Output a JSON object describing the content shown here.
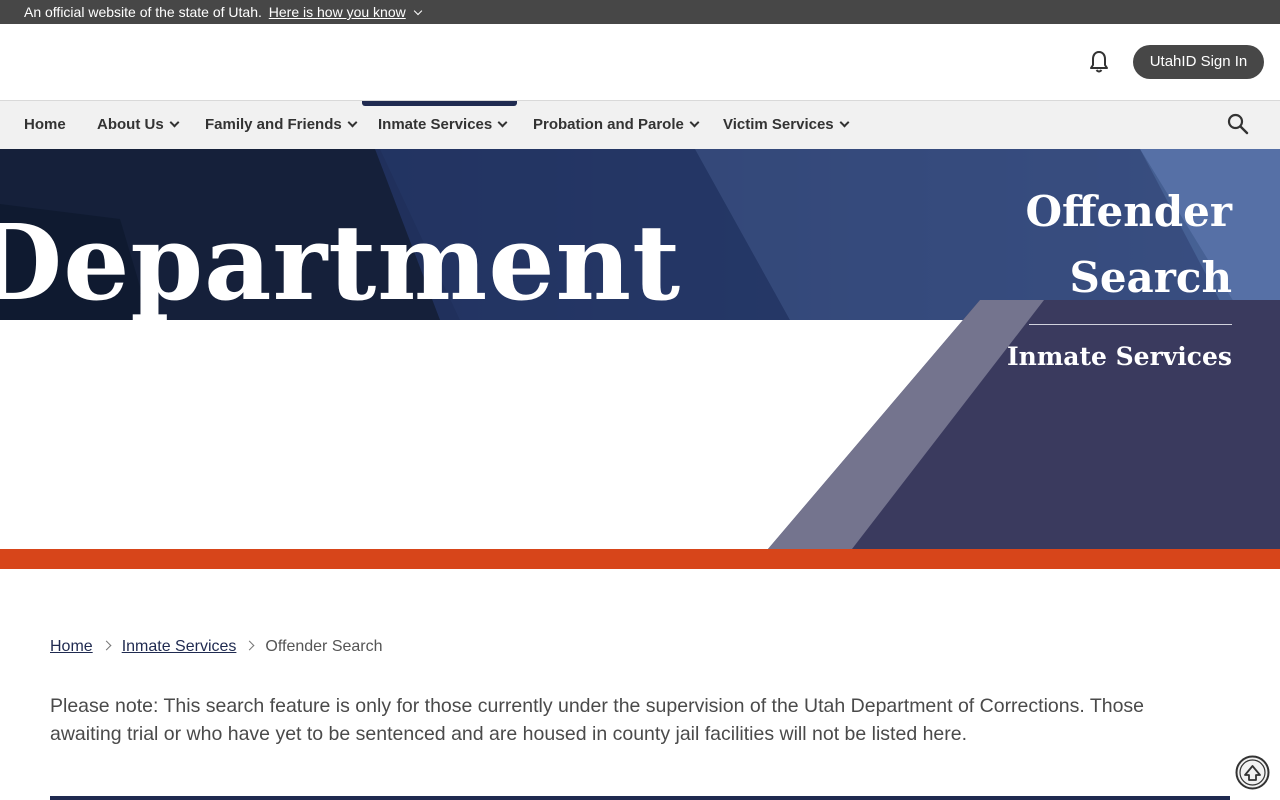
{
  "official_banner": {
    "text": "An official website of the state of Utah.",
    "link_label": "Here is how you know"
  },
  "header": {
    "signin_label": "UtahID Sign In",
    "notification_icon": "bell-icon"
  },
  "nav": {
    "items": [
      {
        "label": "Home"
      },
      {
        "label": "About Us"
      },
      {
        "label": "Family and Friends"
      },
      {
        "label": "Inmate Services"
      },
      {
        "label": "Probation and Parole"
      },
      {
        "label": "Victim Services"
      }
    ],
    "active": "Inmate Services",
    "search_icon": "search-icon"
  },
  "hero": {
    "image_text": "Department",
    "title_line1": "Offender",
    "title_line2": "Search",
    "subtitle": "Inmate Services"
  },
  "breadcrumb": {
    "items": [
      "Home",
      "Inmate Services"
    ],
    "current": "Offender Search"
  },
  "notice": "Please note: This search feature is only for those currently under the supervision of the Utah Department of Corrections. Those awaiting trial or who have yet to be sentenced and are housed in county jail facilities will not be listed here.",
  "colors": {
    "brand_dark": "#474747",
    "navy": "#1f2a50",
    "hero_panel": "#3a3a5e",
    "accent_orange": "#d7451a"
  }
}
